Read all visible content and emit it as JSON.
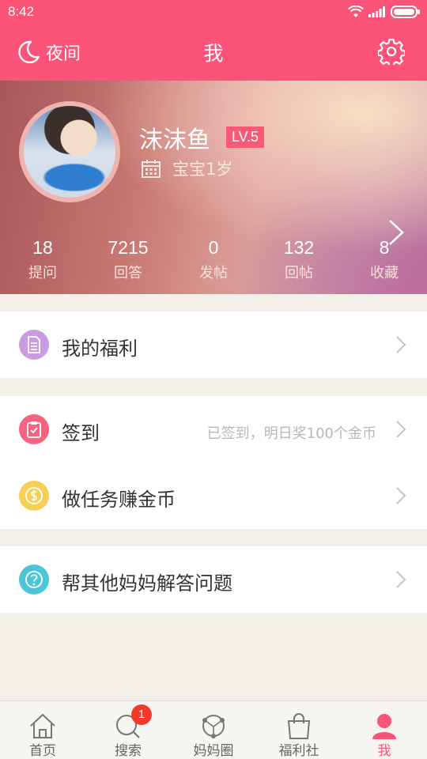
{
  "status_bar": {
    "time": "8:42"
  },
  "header": {
    "night_label": "夜间",
    "title": "我"
  },
  "profile": {
    "username": "沫沫鱼",
    "level": "LV.5",
    "baby_age": "宝宝1岁",
    "stats": [
      {
        "value": "18",
        "label": "提问"
      },
      {
        "value": "7215",
        "label": "回答"
      },
      {
        "value": "0",
        "label": "发帖"
      },
      {
        "value": "132",
        "label": "回帖"
      },
      {
        "value": "8",
        "label": "收藏"
      }
    ]
  },
  "menu": {
    "welfare": {
      "label": "我的福利",
      "icon": "document-icon",
      "color": "#c99be0"
    },
    "checkin": {
      "label": "签到",
      "note": "已签到，明日奖100个金币",
      "icon": "clipboard-check-icon",
      "color": "#f6637e"
    },
    "tasks": {
      "label": "做任务赚金币",
      "icon": "coin-icon",
      "color": "#f8cf55"
    },
    "help": {
      "label": "帮其他妈妈解答问题",
      "icon": "question-icon",
      "color": "#4cc6d6"
    }
  },
  "tabbar": {
    "tabs": [
      {
        "label": "首页",
        "icon": "home-icon"
      },
      {
        "label": "搜索",
        "icon": "search-icon",
        "badge": "1"
      },
      {
        "label": "妈妈圈",
        "icon": "circle-network-icon"
      },
      {
        "label": "福利社",
        "icon": "shopping-bag-icon"
      },
      {
        "label": "我",
        "icon": "person-icon",
        "active": true
      }
    ]
  },
  "colors": {
    "brand": "#fb5478",
    "background": "#f3f0ea"
  }
}
